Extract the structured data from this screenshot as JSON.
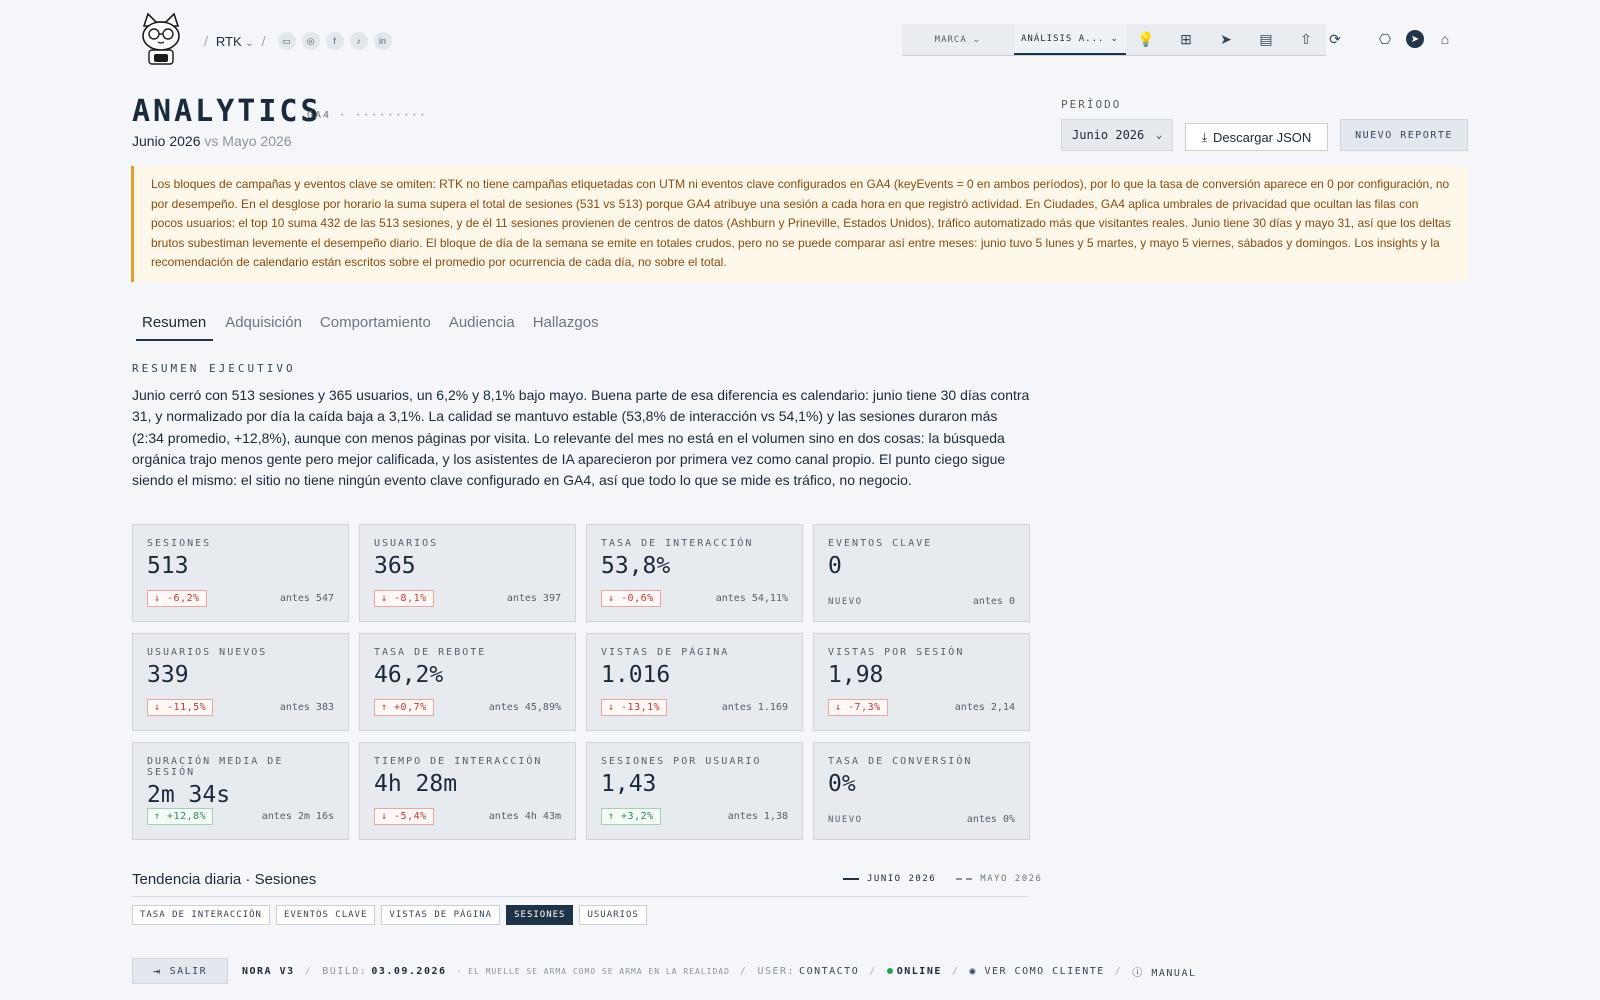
{
  "header": {
    "brand": "RTK",
    "social": [
      "desktop-icon",
      "instagram-icon",
      "facebook-icon",
      "tiktok-icon",
      "linkedin-icon"
    ],
    "nav": [
      {
        "label": "MARCA"
      },
      {
        "label": "ANÁLISIS A..."
      }
    ]
  },
  "page": {
    "title": "ANALYTICS",
    "tag": "GA4 · ·········",
    "current_period": "Junio 2026",
    "compare": "vs Mayo 2026",
    "period_label": "PERÍODO",
    "period_value": "Junio 2026",
    "download_label": "Descargar JSON",
    "new_report_label": "NUEVO REPORTE"
  },
  "alert": {
    "text": "Los bloques de campañas y eventos clave se omiten: RTK no tiene campañas etiquetadas con UTM ni eventos clave configurados en GA4 (keyEvents = 0 en ambos períodos), por lo que la tasa de conversión aparece en 0 por configuración, no por desempeño. En el desglose por horario la suma supera el total de sesiones (531 vs 513) porque GA4 atribuye una sesión a cada hora en que registró actividad. En Ciudades, GA4 aplica umbrales de privacidad que ocultan las filas con pocos usuarios: el top 10 suma 432 de las 513 sesiones, y de él 11 sesiones provienen de centros de datos (Ashburn y Prineville, Estados Unidos), tráfico automatizado más que visitantes reales. Junio tiene 30 días y mayo 31, así que los deltas brutos subestiman levemente el desempeño diario. El bloque de día de la semana se emite en totales crudos, pero no se puede comparar así entre meses: junio tuvo 5 lunes y 5 martes, y mayo 5 viernes, sábados y domingos. Los insights y la recomendación de calendario están escritos sobre el promedio por ocurrencia de cada día, no sobre el total."
  },
  "tabs": [
    "Resumen",
    "Adquisición",
    "Comportamiento",
    "Audiencia",
    "Hallazgos"
  ],
  "summary": {
    "label": "RESUMEN EJECUTIVO",
    "text": "Junio cerró con 513 sesiones y 365 usuarios, un 6,2% y 8,1% bajo mayo. Buena parte de esa diferencia es calendario: junio tiene 30 días contra 31, y normalizado por día la caída baja a 3,1%. La calidad se mantuvo estable (53,8% de interacción vs 54,1%) y las sesiones duraron más (2:34 promedio, +12,8%), aunque con menos páginas por visita. Lo relevante del mes no está en el volumen sino en dos cosas: la búsqueda orgánica trajo menos gente pero mejor calificada, y los asistentes de IA aparecieron por primera vez como canal propio. El punto ciego sigue siendo el mismo: el sitio no tiene ningún evento clave configurado en GA4, así que todo lo que se mide es tráfico, no negocio."
  },
  "kpis": [
    {
      "label": "SESIONES",
      "value": "513",
      "delta": "↓ -6,2%",
      "dir": "down",
      "before": "antes 547"
    },
    {
      "label": "USUARIOS",
      "value": "365",
      "delta": "↓ -8,1%",
      "dir": "down",
      "before": "antes 397"
    },
    {
      "label": "TASA DE INTERACCIÓN",
      "value": "53,8%",
      "delta": "↓ -0,6%",
      "dir": "down",
      "before": "antes 54,11%"
    },
    {
      "label": "EVENTOS CLAVE",
      "value": "0",
      "delta": "NUEVO",
      "dir": "new",
      "before": "antes 0"
    },
    {
      "label": "USUARIOS NUEVOS",
      "value": "339",
      "delta": "↓ -11,5%",
      "dir": "down",
      "before": "antes 383"
    },
    {
      "label": "TASA DE REBOTE",
      "value": "46,2%",
      "delta": "↑ +0,7%",
      "dir": "down",
      "before": "antes 45,89%"
    },
    {
      "label": "VISTAS DE PÁGINA",
      "value": "1.016",
      "delta": "↓ -13,1%",
      "dir": "down",
      "before": "antes 1.169"
    },
    {
      "label": "VISTAS POR SESIÓN",
      "value": "1,98",
      "delta": "↓ -7,3%",
      "dir": "down",
      "before": "antes 2,14"
    },
    {
      "label": "DURACIÓN MEDIA DE SESIÓN",
      "value": "2m 34s",
      "delta": "↑ +12,8%",
      "dir": "up",
      "before": "antes 2m 16s"
    },
    {
      "label": "TIEMPO DE INTERACCIÓN",
      "value": "4h 28m",
      "delta": "↓ -5,4%",
      "dir": "down",
      "before": "antes 4h 43m"
    },
    {
      "label": "SESIONES POR USUARIO",
      "value": "1,43",
      "delta": "↑ +3,2%",
      "dir": "up",
      "before": "antes 1,38"
    },
    {
      "label": "TASA DE CONVERSIÓN",
      "value": "0%",
      "delta": "NUEVO",
      "dir": "new",
      "before": "antes 0%"
    }
  ],
  "trend": {
    "title": "Tendencia diaria · Sesiones",
    "legend_current": "JUNIO 2026",
    "legend_previous": "MAYO 2026",
    "metrics": [
      "TASA DE INTERACCIÓN",
      "EVENTOS CLAVE",
      "VISTAS DE PÁGINA",
      "SESIONES",
      "USUARIOS"
    ],
    "active_metric": "SESIONES"
  },
  "footer": {
    "exit_label": "SALIR",
    "app": "NORA V3",
    "build_label": "BUILD:",
    "build_date": "03.09.2026",
    "motto": "· EL MUELLE SE ARMA COMO SE ARMA EN LA REALIDAD",
    "user_label": "USER:",
    "user_name": "CONTACTO",
    "status": "ONLINE",
    "view_client": "VER COMO CLIENTE",
    "manual": "MANUAL"
  }
}
